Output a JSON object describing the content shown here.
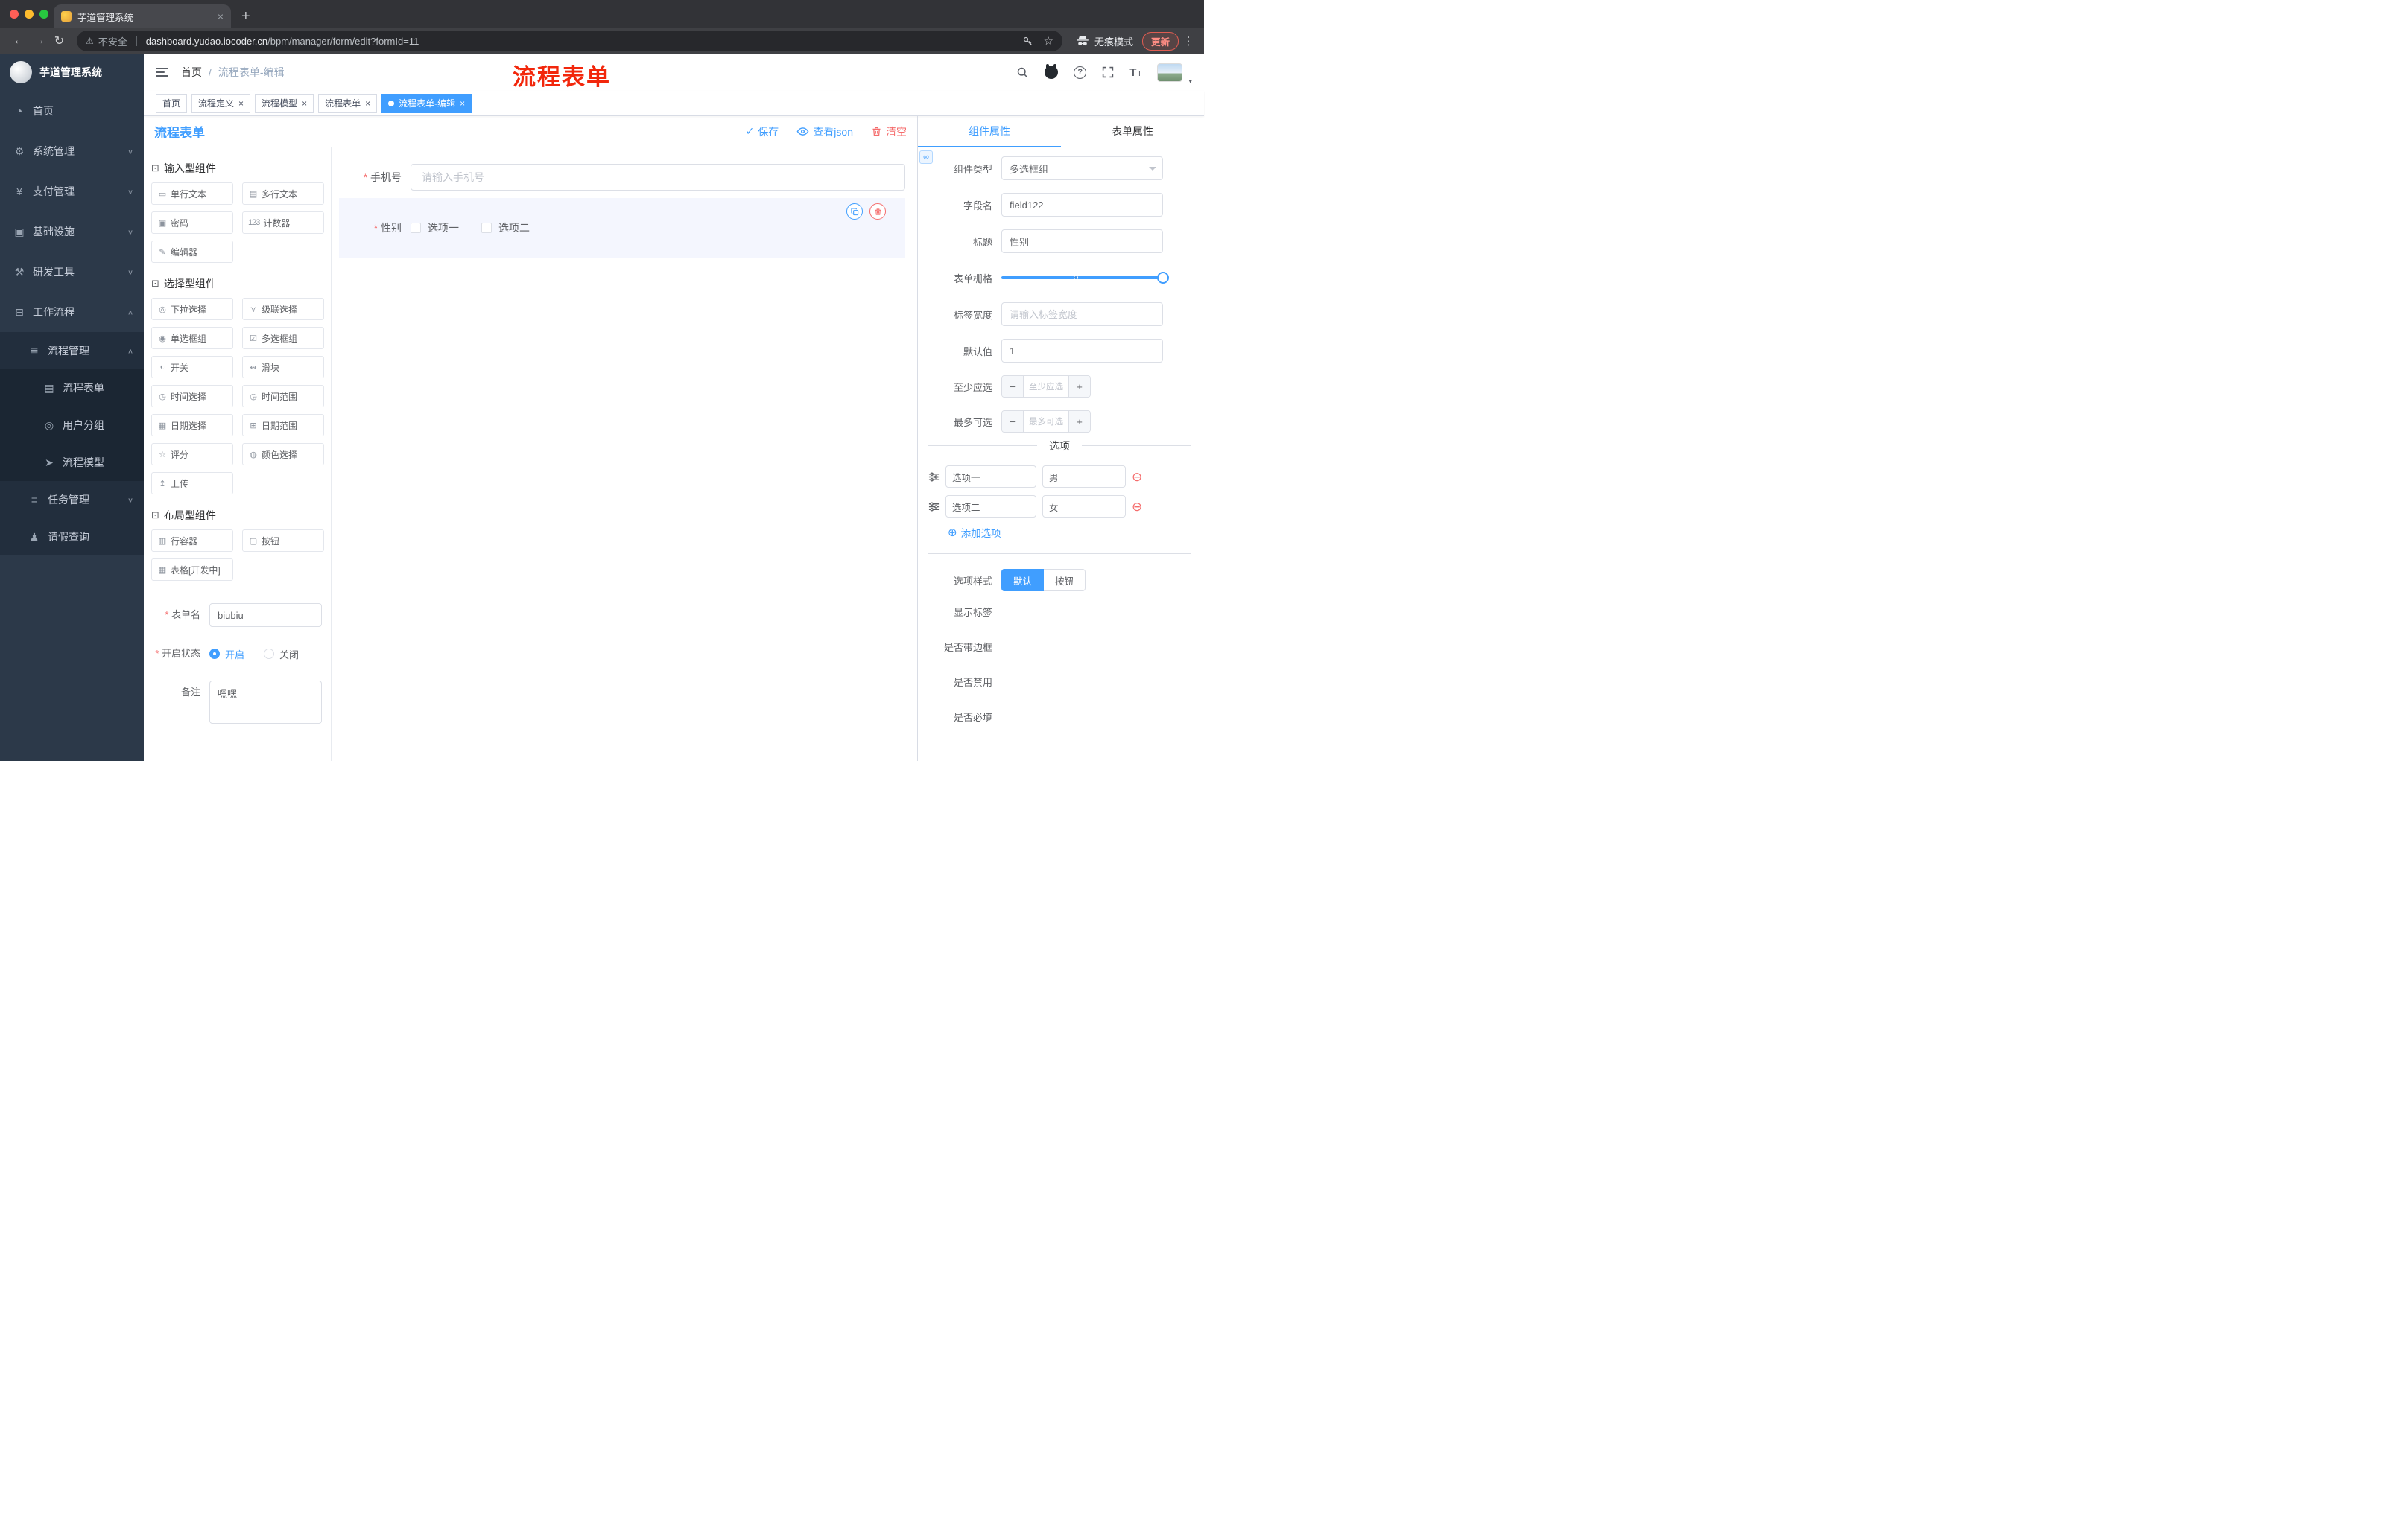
{
  "colors": {
    "accent": "#409eff",
    "danger": "#f56c6c",
    "sidebar_bg": "#2c3949"
  },
  "glyphs": {
    "close": "×",
    "plus": "+",
    "minus": "−",
    "check": "✓",
    "caret_down": "▾",
    "ellipsis": "⋮",
    "back": "←",
    "forward": "→",
    "reload": "↻",
    "star": "☆",
    "warning": "⚠",
    "question": "?",
    "slash": "/",
    "add": "⊕",
    "remove": "⊖",
    "infinity": "∞",
    "letter_t_big": "T",
    "letter_t_small": "T"
  },
  "browser": {
    "tab_title": "芋道管理系统",
    "security_label": "不安全",
    "url_domain": "dashboard.yudao.iocoder.cn",
    "url_path": "/bpm/manager/form/edit?formId=11",
    "incognito_label": "无痕模式",
    "update_label": "更新"
  },
  "sidebar": {
    "title": "芋道管理系统",
    "items": [
      {
        "label": "首页",
        "glyph": "◔"
      },
      {
        "label": "系统管理",
        "glyph": "⚙",
        "chevron": "∨"
      },
      {
        "label": "支付管理",
        "glyph": "¥",
        "chevron": "∨"
      },
      {
        "label": "基础设施",
        "glyph": "▣",
        "chevron": "∨"
      },
      {
        "label": "研发工具",
        "glyph": "⚒",
        "chevron": "∨"
      },
      {
        "label": "工作流程",
        "glyph": "⊟",
        "chevron": "∧"
      },
      {
        "label": "流程管理",
        "glyph": "≣",
        "chevron": "∧"
      },
      {
        "label": "流程表单",
        "glyph": "▤"
      },
      {
        "label": "用户分组",
        "glyph": "◎"
      },
      {
        "label": "流程模型",
        "glyph": "➤"
      },
      {
        "label": "任务管理",
        "glyph": "≡",
        "chevron": "∨"
      },
      {
        "label": "请假查询",
        "glyph": "♟"
      }
    ]
  },
  "header": {
    "breadcrumb": [
      "首页",
      "流程表单-编辑"
    ],
    "annotation": "流程表单"
  },
  "tags": [
    {
      "label": "首页",
      "closable": false,
      "active": false
    },
    {
      "label": "流程定义",
      "closable": true,
      "active": false
    },
    {
      "label": "流程模型",
      "closable": true,
      "active": false
    },
    {
      "label": "流程表单",
      "closable": true,
      "active": false
    },
    {
      "label": "流程表单-编辑",
      "closable": true,
      "active": true
    }
  ],
  "designer": {
    "title": "流程表单",
    "actions": {
      "save": "保存",
      "view_json": "查看json",
      "clear": "清空"
    },
    "palette": {
      "groups": [
        {
          "title": "输入型组件",
          "glyph": "⊡",
          "items": [
            {
              "label": "单行文本",
              "glyph": "▭"
            },
            {
              "label": "多行文本",
              "glyph": "▤"
            },
            {
              "label": "密码",
              "glyph": "▣"
            },
            {
              "label": "计数器",
              "glyph": "123"
            },
            {
              "label": "编辑器",
              "glyph": "✎"
            }
          ]
        },
        {
          "title": "选择型组件",
          "glyph": "⊡",
          "items": [
            {
              "label": "下拉选择",
              "glyph": "◎"
            },
            {
              "label": "级联选择",
              "glyph": "⋎"
            },
            {
              "label": "单选框组",
              "glyph": "◉"
            },
            {
              "label": "多选框组",
              "glyph": "☑"
            },
            {
              "label": "开关",
              "glyph": "◐"
            },
            {
              "label": "滑块",
              "glyph": "↭"
            },
            {
              "label": "时间选择",
              "glyph": "◷"
            },
            {
              "label": "时间范围",
              "glyph": "◶"
            },
            {
              "label": "日期选择",
              "glyph": "▦"
            },
            {
              "label": "日期范围",
              "glyph": "⊞"
            },
            {
              "label": "评分",
              "glyph": "☆"
            },
            {
              "label": "颜色选择",
              "glyph": "◍"
            },
            {
              "label": "上传",
              "glyph": "↥"
            }
          ]
        },
        {
          "title": "布局型组件",
          "glyph": "⊡",
          "items": [
            {
              "label": "行容器",
              "glyph": "▥"
            },
            {
              "label": "按钮",
              "glyph": "▢"
            },
            {
              "label": "表格[开发中]",
              "glyph": "▦"
            }
          ]
        }
      ]
    },
    "form": {
      "name_label": "表单名",
      "name_value": "biubiu",
      "status_label": "开启状态",
      "status_options": [
        "开启",
        "关闭"
      ],
      "status_selected": "开启",
      "remark_label": "备注",
      "remark_value": "嘿嘿"
    },
    "canvas": {
      "phone": {
        "label": "手机号",
        "placeholder": "请输入手机号"
      },
      "gender": {
        "label": "性别",
        "options": [
          "选项一",
          "选项二"
        ],
        "checked": [
          false,
          false
        ]
      }
    }
  },
  "props": {
    "tabs": [
      "组件属性",
      "表单属性"
    ],
    "component_type": {
      "label": "组件类型",
      "value": "多选框组"
    },
    "field_name": {
      "label": "字段名",
      "value": "field122"
    },
    "title": {
      "label": "标题",
      "value": "性别"
    },
    "grid": {
      "label": "表单栅格",
      "value_position": "max"
    },
    "label_width": {
      "label": "标签宽度",
      "placeholder": "请输入标签宽度"
    },
    "default_value": {
      "label": "默认值",
      "value": "1"
    },
    "min_select": {
      "label": "至少应选",
      "placeholder": "至少应选"
    },
    "max_select": {
      "label": "最多可选",
      "placeholder": "最多可选"
    },
    "options_title": "选项",
    "options": [
      {
        "name": "选项一",
        "value": "男"
      },
      {
        "name": "选项二",
        "value": "女"
      }
    ],
    "add_option": "添加选项",
    "option_style": {
      "label": "选项样式",
      "options": [
        "默认",
        "按钮"
      ],
      "selected": "默认"
    },
    "toggles": [
      {
        "label": "显示标签",
        "on": true
      },
      {
        "label": "是否带边框",
        "on": false
      },
      {
        "label": "是否禁用",
        "on": false
      },
      {
        "label": "是否必填",
        "on": true
      }
    ]
  }
}
